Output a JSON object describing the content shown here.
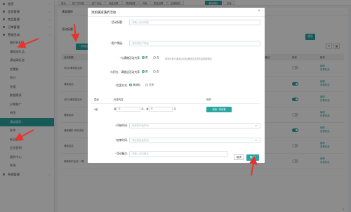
{
  "sidebar": {
    "items": [
      {
        "label": "首页",
        "type": "group"
      },
      {
        "label": "会员管理",
        "type": "group"
      },
      {
        "label": "商品管理",
        "type": "group"
      },
      {
        "label": "订单管理",
        "type": "group"
      },
      {
        "label": "营销活动",
        "type": "group"
      },
      {
        "label": "限时折扣",
        "type": "sub"
      },
      {
        "label": "满就送礼品",
        "type": "sub"
      },
      {
        "label": "满减满折送",
        "type": "sub"
      },
      {
        "label": "优惠券",
        "type": "sub"
      },
      {
        "label": "积分",
        "type": "sub"
      },
      {
        "label": "充值",
        "type": "sub"
      },
      {
        "label": "数据报表",
        "type": "sub"
      },
      {
        "label": "分销推广",
        "type": "sub"
      },
      {
        "label": "拼团",
        "type": "sub"
      },
      {
        "label": "满减满折",
        "type": "sub",
        "active": true
      },
      {
        "label": "秒杀",
        "type": "sub"
      },
      {
        "label": "新品促销",
        "type": "sub"
      },
      {
        "label": "会员营销",
        "type": "sub"
      },
      {
        "label": "福利中心",
        "type": "sub"
      },
      {
        "label": "系统",
        "type": "sub"
      },
      {
        "label": "系统管理",
        "type": "group"
      }
    ]
  },
  "tabs": [
    "首页",
    "推广员列表",
    "推广商品",
    "佣金设置",
    "提现管理",
    "商家",
    "配送设置",
    "店铺装修",
    "满减满折",
    "系统"
  ],
  "main": {
    "breadcrumb": "满减满折",
    "filter_label": "活动标题",
    "add_button": "+ 新增活动",
    "search_button": "搜索",
    "columns": [
      "活动标题",
      "",
      "",
      "",
      "活动备注",
      "状态",
      "操作"
    ],
    "rows": [
      {
        "title": "9月12满双倍活动",
        "status": false,
        "ops": [
          "编辑",
          "查看商品"
        ]
      },
      {
        "title": "满减活动",
        "status": true,
        "ops": [
          "编辑",
          "查看商品"
        ]
      },
      {
        "title": "9月11满双倍活动",
        "status": true,
        "ops": [
          "编辑",
          "查看商品"
        ]
      },
      {
        "title": "满减活动",
        "status": false,
        "ops": [
          "编辑",
          "查看商品"
        ]
      },
      {
        "title": "满减满折 折扣活动",
        "status": true,
        "ops": [
          "编辑",
          "查看商品"
        ]
      },
      {
        "title": "满减活动",
        "status": false,
        "ops": [
          "编辑",
          "查看商品"
        ]
      },
      {
        "title": "满减折扣活动-一周",
        "status": false,
        "ops": [
          "编辑",
          "查看商品"
        ]
      }
    ],
    "page_text": "1"
  },
  "modal": {
    "title": "添加满减满折活动",
    "close": "×",
    "fields": {
      "activity_title": {
        "label": "活动标题:",
        "placeholder": "请输入活动标题"
      },
      "user_level": {
        "label": "用户等级:",
        "placeholder": "请选择用户等级"
      },
      "stack_coupon": {
        "label": "与满赠活动共享:",
        "opt_yes": "是",
        "opt_no": "否",
        "hint": "若同时参与满减活动及满就送活动的金额都满足",
        "selected": "yes"
      },
      "stack_promo": {
        "label": "与积分、满就送活动共享:",
        "opt_yes": "是",
        "opt_no": "否",
        "selected": "yes"
      },
      "discount_type": {
        "label": "优惠方式:",
        "opt_a": "满减免",
        "opt_b": "打折",
        "selected": "a"
      },
      "tier_table": {
        "headers": [
          "层级",
          "优惠内容",
          "操作"
        ],
        "rows": [
          {
            "level": "1级",
            "prefix": "满",
            "amount": "0",
            "unit1": "元，减",
            "reduce": "0",
            "unit2": "元"
          }
        ],
        "add_button": "添加一条设置"
      },
      "start_time": {
        "label": "开始时间:",
        "placeholder": "请选择开始时间"
      },
      "end_time": {
        "label": "结束时间:",
        "placeholder": "请选择结束时间"
      },
      "remark": {
        "label": "活动备注:",
        "placeholder": "请输入活动备注"
      }
    },
    "cancel": "取消",
    "ok": "确 定"
  },
  "colors": {
    "accent": "#2aa6a0",
    "annotation_arrow": "#e8322b"
  }
}
